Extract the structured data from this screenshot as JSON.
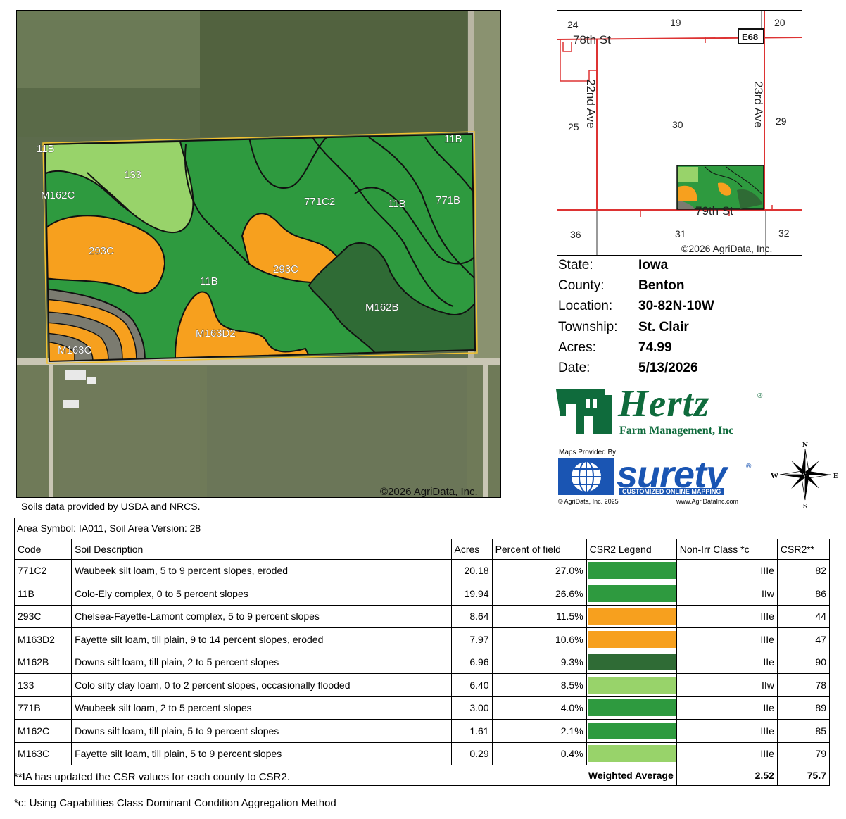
{
  "main_map": {
    "copyright": "©2026 AgriData, Inc.",
    "soil_labels": [
      "11B",
      "11B",
      "133",
      "M162C",
      "771C2",
      "11B",
      "771B",
      "293C",
      "293C",
      "11B",
      "M162B",
      "M163D2",
      "M163C"
    ]
  },
  "soils_note": "Soils data provided by USDA and NRCS.",
  "inset_map": {
    "section_numbers": [
      "24",
      "19",
      "20",
      "25",
      "30",
      "29",
      "36",
      "31",
      "32"
    ],
    "roads": [
      "78th St",
      "22nd Ave",
      "23rd Ave",
      "79th St"
    ],
    "highway_badge": "E68",
    "copyright": "©2026 AgriData, Inc."
  },
  "info": [
    {
      "key": "State:",
      "value": "Iowa"
    },
    {
      "key": "County:",
      "value": "Benton"
    },
    {
      "key": "Location:",
      "value": "30-82N-10W"
    },
    {
      "key": "Township:",
      "value": "St. Clair"
    },
    {
      "key": "Acres:",
      "value": "74.99"
    },
    {
      "key": "Date:",
      "value": "5/13/2026"
    }
  ],
  "hertz": {
    "name": "Hertz",
    "registered": "®",
    "subtitle": "Farm Management, Inc",
    "color": "#0f6b3c"
  },
  "surety": {
    "maps_provided": "Maps Provided By:",
    "word": "surety",
    "registered": "®",
    "tagline": "CUSTOMIZED ONLINE MAPPING",
    "copyright": "© AgriData, Inc. 2025",
    "url": "www.AgriDataInc.com",
    "color": "#1a55b3"
  },
  "compass": {
    "n": "N",
    "s": "S",
    "e": "E",
    "w": "W"
  },
  "soil_table": {
    "area_symbol": "Area Symbol: IA011, Soil Area Version: 28",
    "headers": [
      "Code",
      "Soil Description",
      "Acres",
      "Percent of field",
      "CSR2 Legend",
      "Non-Irr Class *c",
      "CSR2**"
    ],
    "rows": [
      {
        "code": "771C2",
        "description": "Waubeek silt loam, 5 to 9 percent slopes, eroded",
        "acres": "20.18",
        "percent": "27.0%",
        "legend_color": "#2e9a3f",
        "class": "IIIe",
        "csr2": "82"
      },
      {
        "code": "11B",
        "description": "Colo-Ely complex, 0 to 5 percent slopes",
        "acres": "19.94",
        "percent": "26.6%",
        "legend_color": "#2e9a3f",
        "class": "IIw",
        "csr2": "86"
      },
      {
        "code": "293C",
        "description": "Chelsea-Fayette-Lamont complex, 5 to 9 percent slopes",
        "acres": "8.64",
        "percent": "11.5%",
        "legend_color": "#f7a01e",
        "class": "IIIe",
        "csr2": "44"
      },
      {
        "code": "M163D2",
        "description": "Fayette silt loam, till plain, 9 to 14 percent slopes, eroded",
        "acres": "7.97",
        "percent": "10.6%",
        "legend_color": "#f7a01e",
        "class": "IIIe",
        "csr2": "47"
      },
      {
        "code": "M162B",
        "description": "Downs silt loam, till plain, 2 to 5 percent slopes",
        "acres": "6.96",
        "percent": "9.3%",
        "legend_color": "#2f6b35",
        "class": "IIe",
        "csr2": "90"
      },
      {
        "code": "133",
        "description": "Colo silty clay loam, 0 to 2 percent slopes, occasionally flooded",
        "acres": "6.40",
        "percent": "8.5%",
        "legend_color": "#98d36a",
        "class": "IIw",
        "csr2": "78"
      },
      {
        "code": "771B",
        "description": "Waubeek silt loam, 2 to 5 percent slopes",
        "acres": "3.00",
        "percent": "4.0%",
        "legend_color": "#2e9a3f",
        "class": "IIe",
        "csr2": "89"
      },
      {
        "code": "M162C",
        "description": "Downs silt loam, till plain, 5 to 9 percent slopes",
        "acres": "1.61",
        "percent": "2.1%",
        "legend_color": "#2e9a3f",
        "class": "IIIe",
        "csr2": "85"
      },
      {
        "code": "M163C",
        "description": "Fayette silt loam, till plain, 5 to 9 percent slopes",
        "acres": "0.29",
        "percent": "0.4%",
        "legend_color": "#98d36a",
        "class": "IIIe",
        "csr2": "79"
      }
    ],
    "weighted_average": {
      "label": "Weighted Average",
      "class": "2.52",
      "csr2": "75.7"
    }
  },
  "footnotes": [
    "**IA has updated the CSR values for each county to CSR2.",
    "*c: Using Capabilities Class Dominant Condition Aggregation Method"
  ]
}
